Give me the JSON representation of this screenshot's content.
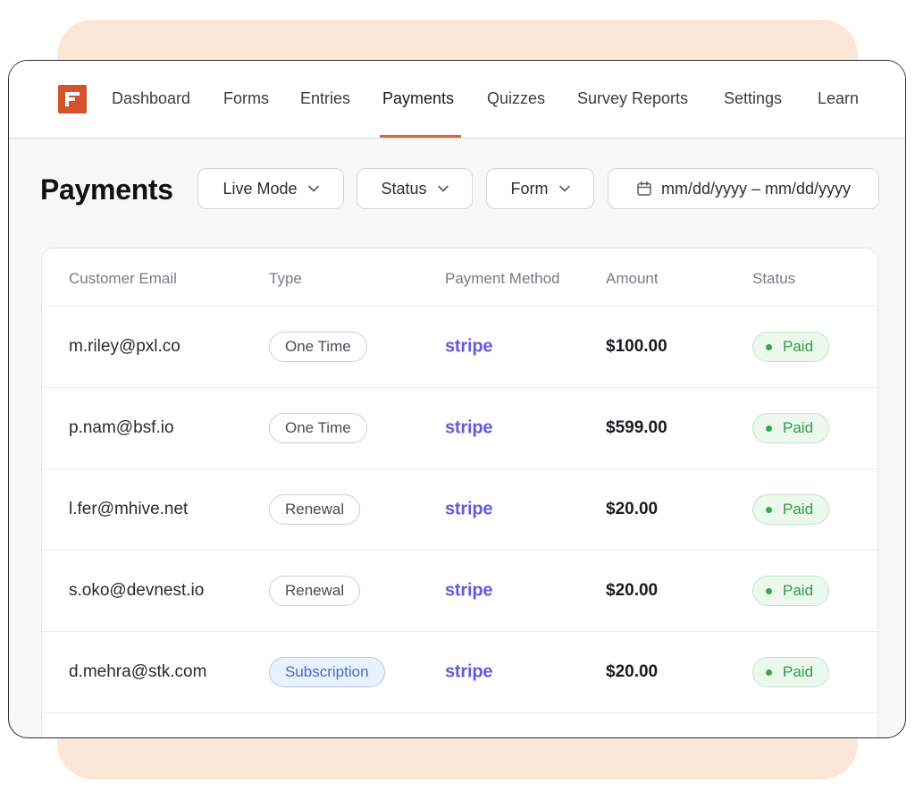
{
  "nav": {
    "logo_icon": "fluentforms-logo-icon",
    "items": [
      {
        "label": "Dashboard",
        "active": false
      },
      {
        "label": "Forms",
        "active": false
      },
      {
        "label": "Entries",
        "active": false
      },
      {
        "label": "Payments",
        "active": true
      },
      {
        "label": "Quizzes",
        "active": false
      },
      {
        "label": "Survey Reports",
        "active": false
      },
      {
        "label": "Settings",
        "active": false
      },
      {
        "label": "Learn",
        "active": false
      }
    ]
  },
  "page": {
    "title": "Payments"
  },
  "filters": {
    "mode": "Live Mode",
    "status": "Status",
    "form": "Form",
    "date_range_placeholder": "mm/dd/yyyy – mm/dd/yyyy"
  },
  "table": {
    "columns": [
      "Customer Email",
      "Type",
      "Payment Method",
      "Amount",
      "Status"
    ],
    "rows": [
      {
        "email": "m.riley@pxl.co",
        "type": "One Time",
        "method": "stripe",
        "amount": "$100.00",
        "status": "Paid"
      },
      {
        "email": "p.nam@bsf.io",
        "type": "One Time",
        "method": "stripe",
        "amount": "$599.00",
        "status": "Paid"
      },
      {
        "email": "l.fer@mhive.net",
        "type": "Renewal",
        "method": "stripe",
        "amount": "$20.00",
        "status": "Paid"
      },
      {
        "email": "s.oko@devnest.io",
        "type": "Renewal",
        "method": "stripe",
        "amount": "$20.00",
        "status": "Paid"
      },
      {
        "email": "d.mehra@stk.com",
        "type": "Subscription",
        "method": "stripe",
        "amount": "$20.00",
        "status": "Paid"
      }
    ]
  },
  "colors": {
    "accent": "#e45f35",
    "logo": "#d4532c",
    "stripe": "#635bd9",
    "paid_green": "#2f9b47",
    "subscription_blue": "#3f6fc9",
    "backdrop": "#fbe7d8"
  }
}
